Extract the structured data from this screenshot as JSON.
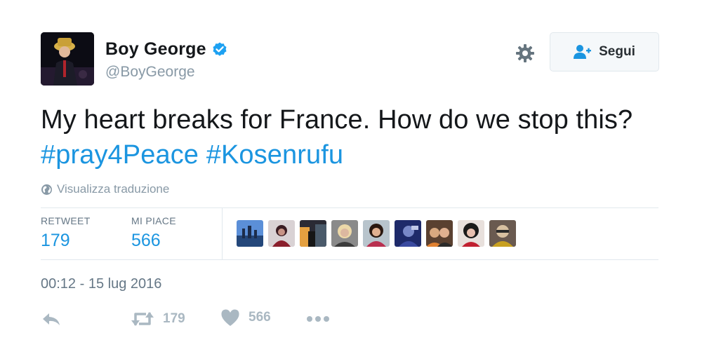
{
  "colors": {
    "accent": "#1b95e0",
    "muted": "#8899a6",
    "action": "#aab8c2",
    "verified": "#1da1f2"
  },
  "user": {
    "display_name": "Boy George",
    "handle": "@BoyGeorge",
    "verified": true,
    "avatar_icon": "avatar"
  },
  "header": {
    "settings_icon": "gear-icon",
    "follow_label": "Segui",
    "follow_icon": "add-user-icon"
  },
  "tweet": {
    "text_plain": "My heart breaks for France. How do we stop this?",
    "hashtags": [
      "#pray4Peace",
      "#Kosenrufu"
    ],
    "translate_label": "Visualizza traduzione",
    "translate_icon": "globe-icon"
  },
  "stats": {
    "retweet_label": "RETWEET",
    "retweet_count": "179",
    "like_label": "MI PIACE",
    "like_count": "566"
  },
  "likers": [
    "avatar-1",
    "avatar-2",
    "avatar-3",
    "avatar-4",
    "avatar-5",
    "avatar-6",
    "avatar-7",
    "avatar-8",
    "avatar-9"
  ],
  "timestamp": "00:12 - 15 lug 2016",
  "actions": {
    "reply_icon": "reply-icon",
    "retweet_icon": "retweet-icon",
    "retweet_count": "179",
    "like_icon": "heart-icon",
    "like_count": "566",
    "more_icon": "more-icon"
  }
}
